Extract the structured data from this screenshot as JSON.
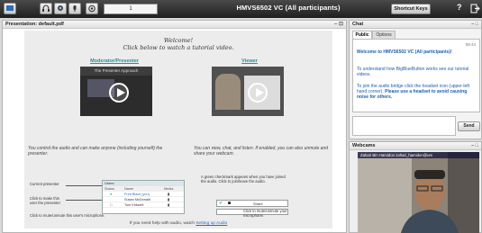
{
  "toolbar": {
    "field_value": "1",
    "title": "HMVS6502 VC (All participants)",
    "shortcut_label": "Shortcut Keys",
    "help_label": "?"
  },
  "presentation": {
    "header": "Presentation: default.pdf",
    "controls": "– ⊡",
    "welcome_line1": "Welcome!",
    "welcome_line2": "Click below to watch a tutorial video.",
    "moderator_title": "Moderator/Presenter",
    "viewer_title": "Viewer",
    "video_caption": "The Presenter Approach",
    "moderator_desc": "You control the audio and can make anyone (including yourself) the presenter.",
    "viewer_desc": "You can view, chat, and listen. If enabled, you can also unmute and share your webcam.",
    "table_head": "Users",
    "table_cols": [
      "Status",
      "Name",
      "Media"
    ],
    "table_rows": [
      {
        "name": "Fred Black (you)"
      },
      {
        "name": "Susan McDonald"
      },
      {
        "name": "Tom Kirkwell"
      }
    ],
    "note_current_presenter": "Current presenter",
    "note_make_presenter": "Click to make this user the presenter",
    "note_mute_user": "Click to mute/unmute this user's microphone.",
    "note_checkmark": "A green checkmark appears when you have joined the audio. Click to join/leave the audio.",
    "note_mute_mic": "Click to mute/unmute your microphone.",
    "strip_label": "Share",
    "setup_text": "If you need help with audio, watch ",
    "setup_link": "Setting up Audio"
  },
  "chat": {
    "header": "Chat",
    "controls": "– □",
    "tab_public": "Public",
    "tab_options": "Options",
    "time": "08:44",
    "msg_welcome": "Welcome to HMVS6502 VC (All participants)!",
    "msg_tutorial": "To understand how BigBlueButton works see our tutorial videos.",
    "msg_audio_1": "To join the audio bridge click the headset icon (upper-left hand corner). ",
    "msg_audio_2": "Please use a headset to avoid causing noise for others.",
    "send_label": "Send"
  },
  "webcams": {
    "header": "Webcams",
    "controls": "– □",
    "cam_label": "Zahari Bin Hamidon zahari_hamidon@um"
  }
}
